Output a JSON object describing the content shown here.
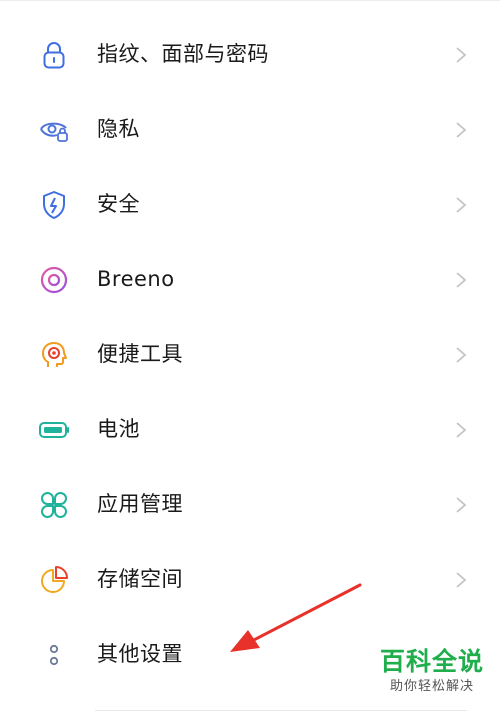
{
  "settings": {
    "items": [
      {
        "label": "指纹、面部与密码",
        "icon": "fingerprint-lock-icon",
        "color": "#3f6fe0"
      },
      {
        "label": "隐私",
        "icon": "privacy-eye-icon",
        "color": "#4e73d9"
      },
      {
        "label": "安全",
        "icon": "security-shield-icon",
        "color": "#3f6fe0"
      },
      {
        "label": "Breeno",
        "icon": "breeno-icon",
        "color": "#c04fd6"
      },
      {
        "label": "便捷工具",
        "icon": "convenience-tools-icon",
        "color": "#f29a1f"
      },
      {
        "label": "电池",
        "icon": "battery-icon",
        "color": "#1eb39a"
      },
      {
        "label": "应用管理",
        "icon": "app-management-icon",
        "color": "#1eb39a"
      },
      {
        "label": "存储空间",
        "icon": "storage-icon",
        "color": "#f2a81f"
      },
      {
        "label": "其他设置",
        "icon": "more-settings-icon",
        "color": "#6a7a99"
      }
    ]
  },
  "annotation": {
    "arrow_color": "#e8312b"
  },
  "watermark": {
    "title": "百科全说",
    "subtitle": "助你轻松解决",
    "color": "#1fae4b"
  }
}
